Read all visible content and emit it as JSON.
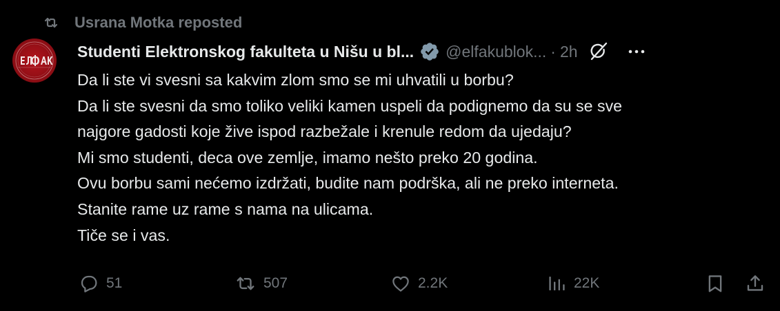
{
  "repost": {
    "icon": "repost-icon",
    "text": "Usrana Motka reposted"
  },
  "author": {
    "avatar_icon": "elfak-logo",
    "display_name": "Studenti Elektronskog fakulteta u Nišu u bl...",
    "verified_icon": "verified-badge-icon",
    "handle": "@elfakublok...",
    "separator": "·",
    "time": "2h"
  },
  "header_icons": {
    "grok": "grok-icon",
    "more": "more-icon"
  },
  "tweet": {
    "lines": [
      "Da li ste vi svesni sa kakvim zlom smo se mi uhvatili u borbu?",
      "Da li ste svesni da smo toliko veliki kamen uspeli da podignemo da su se sve",
      "najgore gadosti koje žive ispod razbežale i krenule redom da ujedaju?",
      "Mi smo studenti, deca ove zemlje, imamo nešto preko 20 godina.",
      "Ovu borbu sami nećemo izdržati, budite nam podrška, ali ne preko interneta.",
      "Stanite rame uz rame s nama na ulicama.",
      "Tiče se i vas."
    ]
  },
  "actions": {
    "reply": {
      "icon": "reply-icon",
      "count": "51"
    },
    "repost": {
      "icon": "repost-icon",
      "count": "507"
    },
    "like": {
      "icon": "heart-icon",
      "count": "2.2K"
    },
    "views": {
      "icon": "views-icon",
      "count": "22K"
    },
    "bookmark": {
      "icon": "bookmark-icon"
    },
    "share": {
      "icon": "share-icon"
    }
  },
  "colors": {
    "background": "#000000",
    "text_primary": "#e7e9ea",
    "text_secondary": "#71767b",
    "verified": "#829aab",
    "avatar": "#a0121a"
  }
}
